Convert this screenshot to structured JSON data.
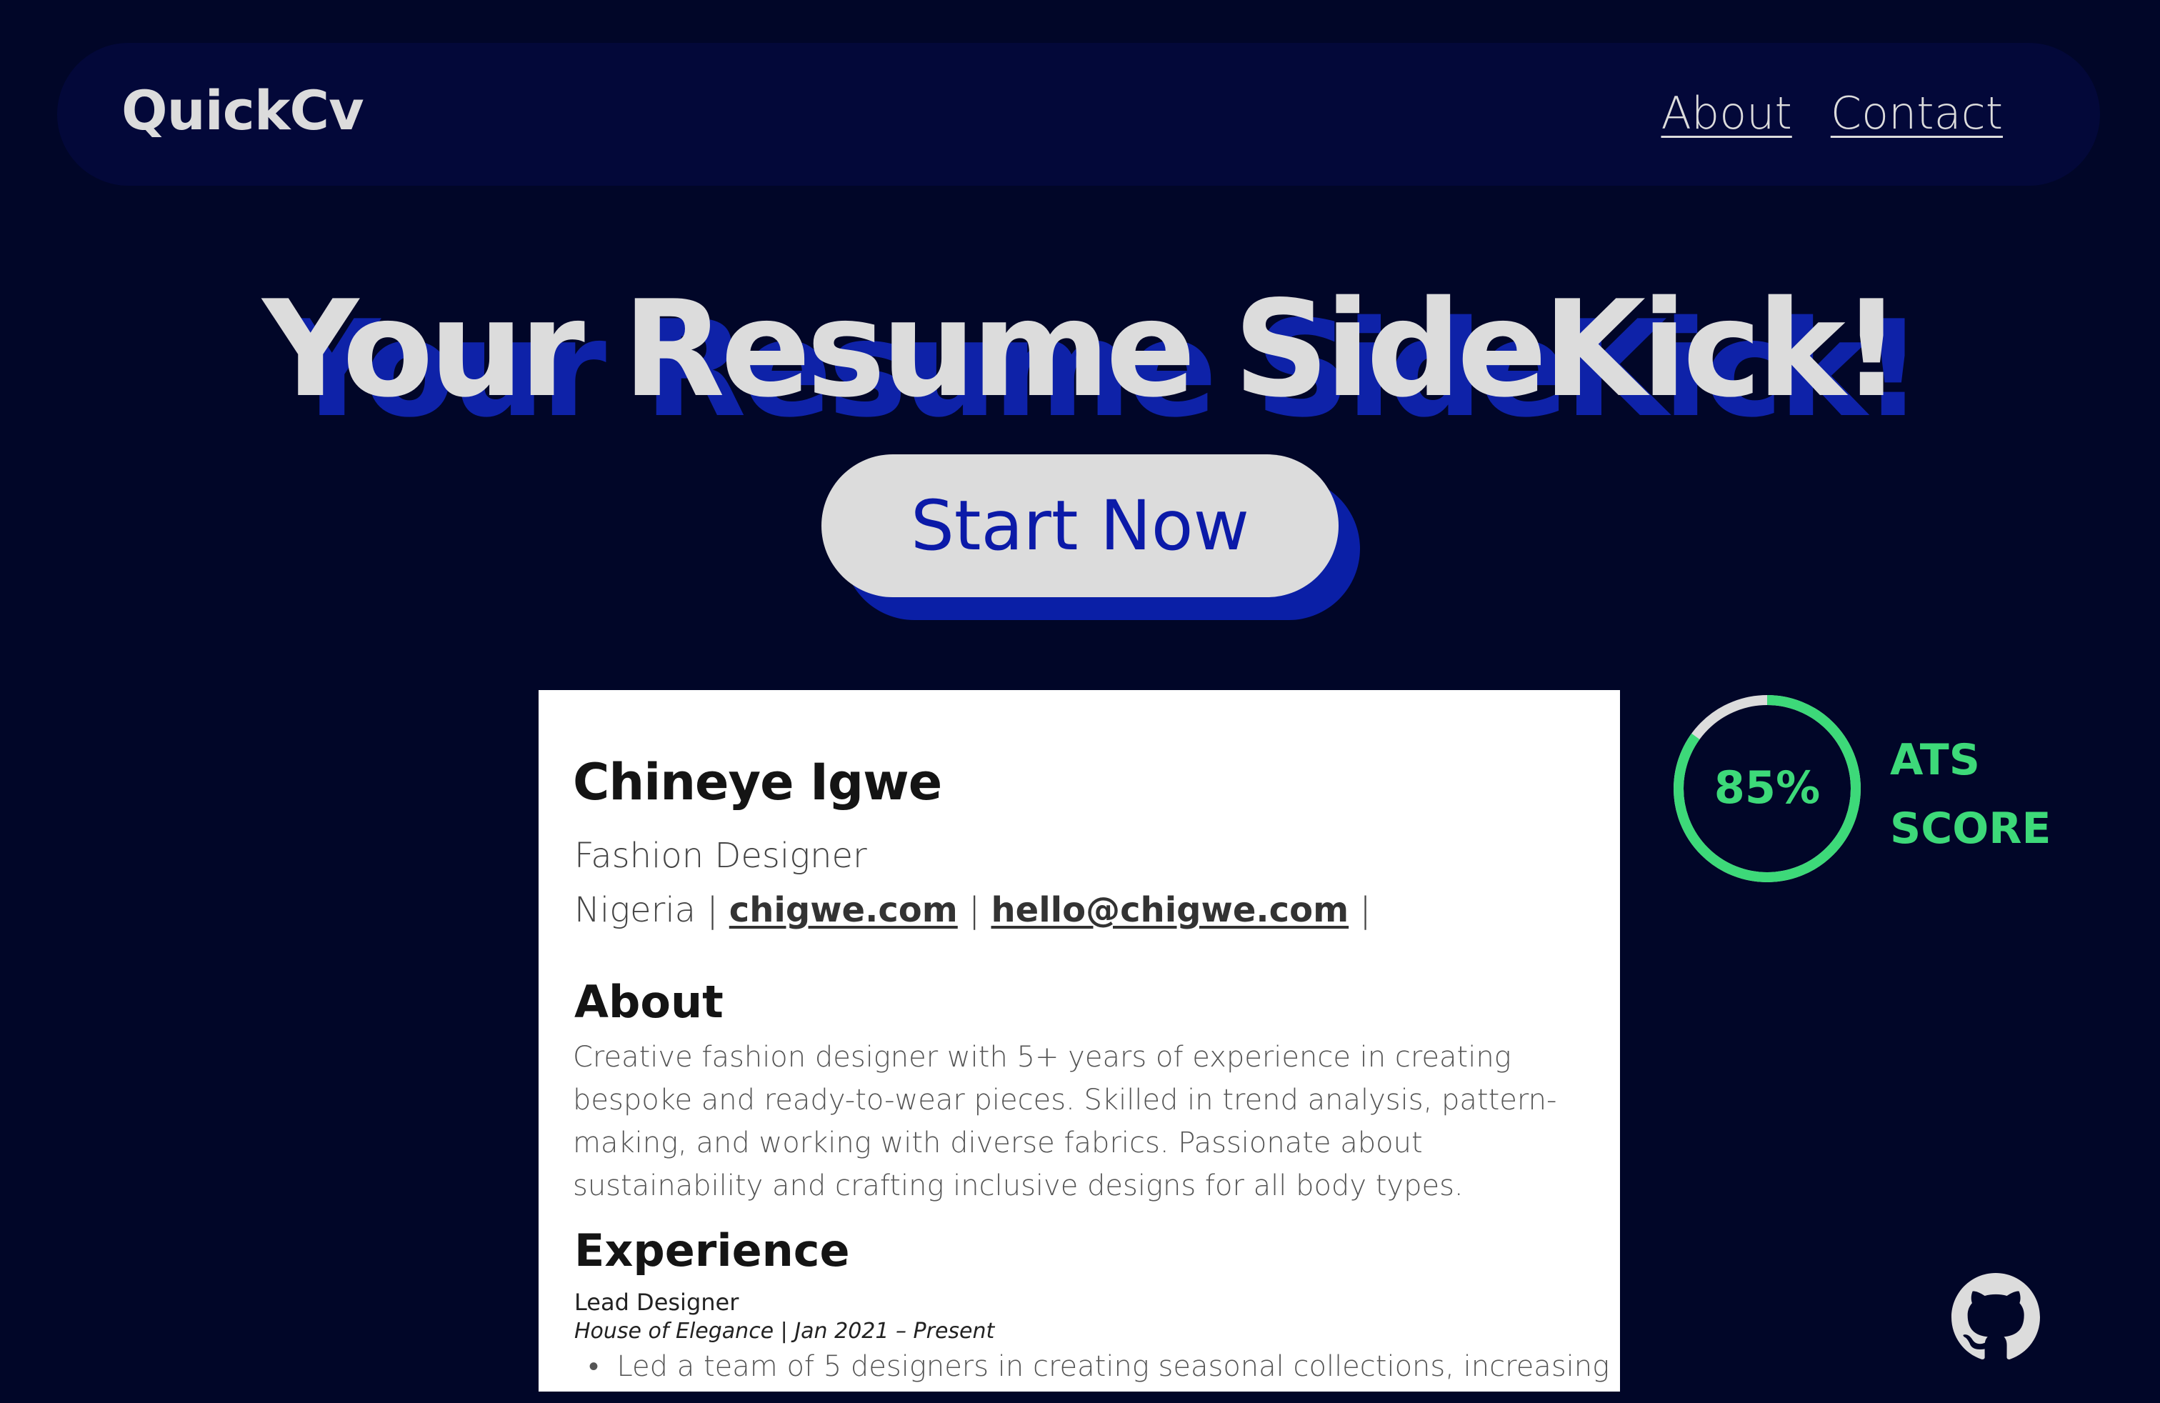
{
  "nav": {
    "brand": "QuickCv",
    "links": [
      {
        "label": "About"
      },
      {
        "label": "Contact"
      }
    ]
  },
  "hero": {
    "title": "Your Resume SideKick!",
    "cta_label": "Start Now"
  },
  "resume": {
    "name": "Chineye Igwe",
    "title": "Fashion Designer",
    "location": "Nigeria",
    "website": "chigwe.com",
    "email": "hello@chigwe.com",
    "separator": "|",
    "about_heading": "About",
    "about_text": "Creative fashion designer with 5+ years of experience in creating bespoke and ready-to-wear pieces. Skilled in trend analysis, pattern-making, and working with diverse fabrics. Passionate about sustainability and crafting inclusive designs for all body types.",
    "experience_heading": "Experience",
    "job": {
      "title": "Lead Designer",
      "meta": "House of Elegance | Jan 2021 – Present",
      "bullet": "Led a team of 5 designers in creating seasonal collections, increasing"
    }
  },
  "ats": {
    "percent_text": "85%",
    "fraction": 0.85,
    "label_line1": "ATS",
    "label_line2": "SCORE",
    "color": "#3dd979",
    "track_color": "#dcdcdc"
  },
  "icons": {
    "github": "github-icon"
  },
  "colors": {
    "background": "#010628",
    "nav_bg": "#030839",
    "accent_blue": "#0b1aa8",
    "light": "#dcdcdc"
  }
}
